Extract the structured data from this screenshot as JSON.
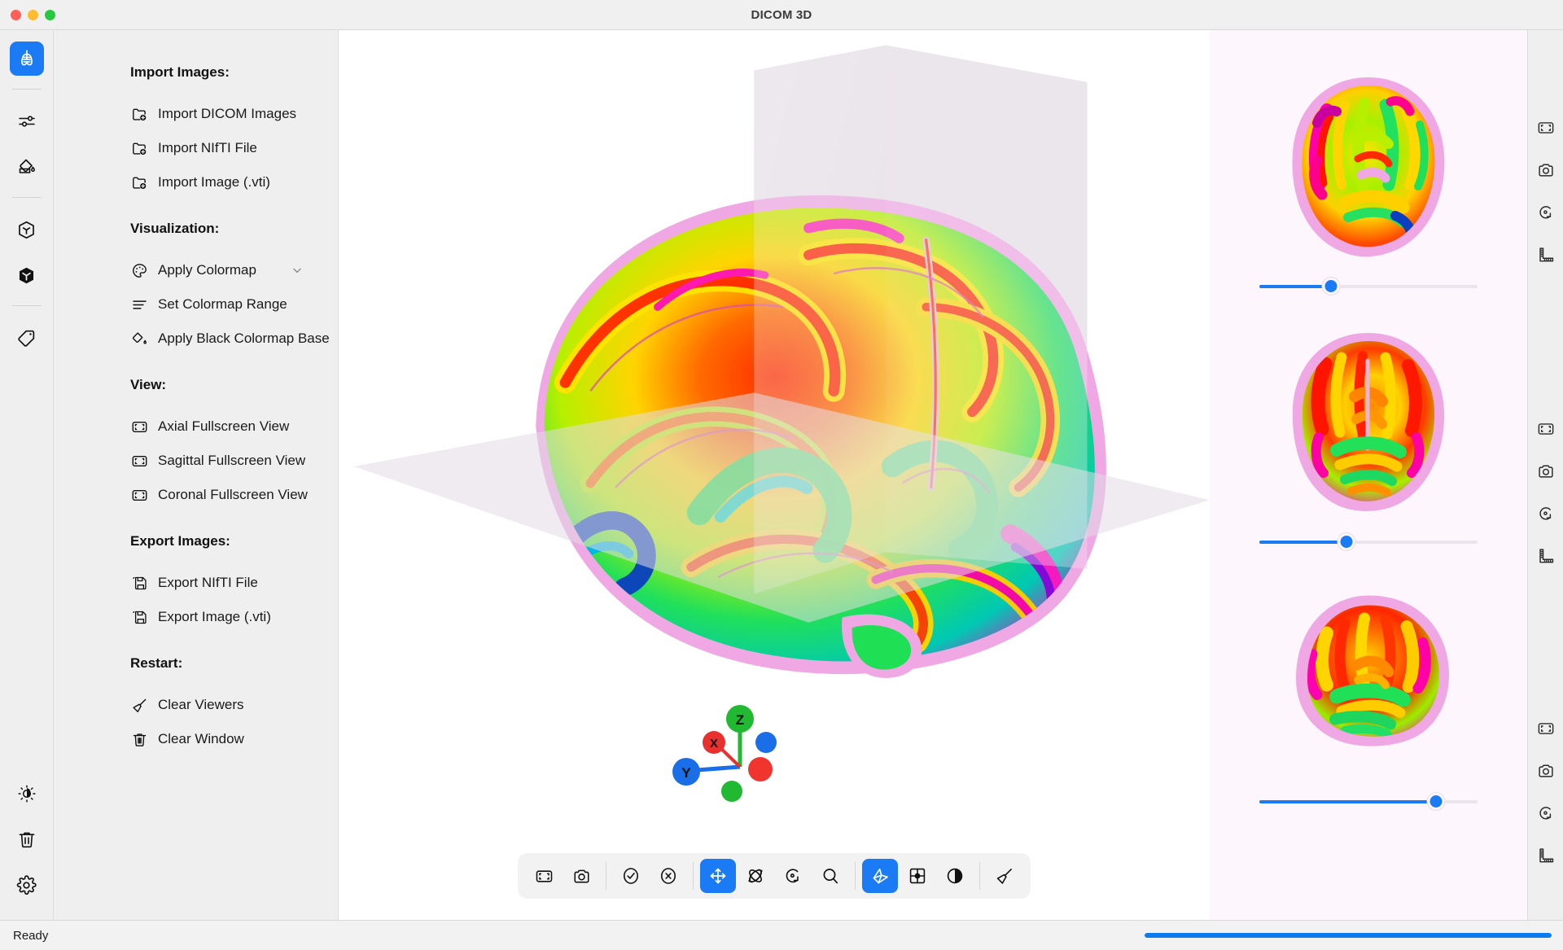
{
  "window": {
    "title": "DICOM 3D",
    "traffic_lights": [
      "close",
      "minimize",
      "maximize"
    ]
  },
  "left_rail": {
    "items": [
      {
        "icon": "lungs-icon",
        "active": true
      },
      {
        "icon": "sliders-icon",
        "active": false
      },
      {
        "icon": "paint-bucket-icon",
        "active": false
      },
      {
        "icon": "cube-outline-icon",
        "active": false
      },
      {
        "icon": "cube-filled-icon",
        "active": false
      },
      {
        "icon": "tag-icon",
        "active": false
      }
    ],
    "bottom_items": [
      {
        "icon": "brightness-icon"
      },
      {
        "icon": "trash-icon"
      },
      {
        "icon": "gear-icon"
      }
    ]
  },
  "menu": {
    "sections": [
      {
        "heading": "Import Images:",
        "items": [
          {
            "label": "Import DICOM Images",
            "icon": "folder-add-icon"
          },
          {
            "label": "Import NIfTI File",
            "icon": "folder-add-icon"
          },
          {
            "label": "Import Image (.vti)",
            "icon": "folder-add-icon"
          }
        ]
      },
      {
        "heading": "Visualization:",
        "items": [
          {
            "label": "Apply Colormap",
            "icon": "palette-icon",
            "chevron": "chevron-down-icon"
          },
          {
            "label": "Set Colormap Range",
            "icon": "lines-icon"
          },
          {
            "label": "Apply Black Colormap Base",
            "icon": "paint-drop-icon"
          }
        ]
      },
      {
        "heading": "View:",
        "items": [
          {
            "label": "Axial Fullscreen View",
            "icon": "fullscreen-icon"
          },
          {
            "label": "Sagittal Fullscreen View",
            "icon": "fullscreen-icon"
          },
          {
            "label": "Coronal Fullscreen View",
            "icon": "fullscreen-icon"
          }
        ]
      },
      {
        "heading": "Export Images:",
        "items": [
          {
            "label": "Export NIfTI File",
            "icon": "save-icon"
          },
          {
            "label": "Export Image (.vti)",
            "icon": "save-icon"
          }
        ]
      },
      {
        "heading": "Restart:",
        "items": [
          {
            "label": "Clear Viewers",
            "icon": "broom-icon"
          },
          {
            "label": "Clear Window",
            "icon": "trash-icon"
          }
        ]
      }
    ]
  },
  "viewport": {
    "render_mode": "3D volume with orthogonal slice planes",
    "orientation_widget": {
      "axes": [
        {
          "label": "X",
          "color": "#e8312f"
        },
        {
          "label": "Y",
          "color": "#1a6ee8"
        },
        {
          "label": "Z",
          "color": "#21b832"
        }
      ]
    }
  },
  "toolbar": {
    "buttons": [
      {
        "icon": "fullscreen-icon",
        "active": false
      },
      {
        "icon": "camera-icon",
        "active": false
      },
      {
        "sep": true
      },
      {
        "icon": "check-circle-icon",
        "active": false
      },
      {
        "icon": "x-circle-icon",
        "active": false
      },
      {
        "sep": true
      },
      {
        "icon": "move-icon",
        "active": true
      },
      {
        "icon": "rotate-3d-icon",
        "active": false
      },
      {
        "icon": "rotate-icon",
        "active": false
      },
      {
        "icon": "zoom-icon",
        "active": false
      },
      {
        "sep": true
      },
      {
        "icon": "slice-icon",
        "active": true
      },
      {
        "icon": "grid-layout-icon",
        "active": false
      },
      {
        "icon": "contrast-icon",
        "active": false
      },
      {
        "sep": true
      },
      {
        "icon": "broom-icon",
        "active": false
      }
    ]
  },
  "thumbnails": {
    "panels": [
      {
        "view": "axial",
        "slider_percent": 33
      },
      {
        "view": "coronal",
        "slider_percent": 40
      },
      {
        "view": "sagittal",
        "slider_percent": 81
      }
    ]
  },
  "right_rail": {
    "groups": [
      {
        "icons": [
          "fullscreen-icon",
          "camera-icon",
          "rotate-icon",
          "ruler-icon"
        ]
      },
      {
        "icons": [
          "fullscreen-icon",
          "camera-icon",
          "rotate-icon",
          "ruler-icon"
        ]
      },
      {
        "icons": [
          "fullscreen-icon",
          "camera-icon",
          "rotate-icon",
          "ruler-icon"
        ]
      }
    ]
  },
  "status": {
    "text": "Ready",
    "progress_percent": 100
  },
  "colors": {
    "accent": "#1a7bf5",
    "progress": "#0a7cf0",
    "panel_bg": "#efefef",
    "thumb_bg": "#fdf6fd",
    "brain_pink": "#f0a0e0"
  }
}
